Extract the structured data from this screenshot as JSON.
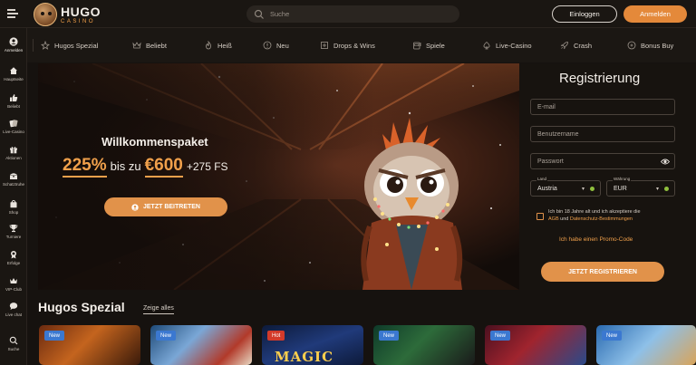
{
  "header": {
    "logo_line1": "HUGO",
    "logo_line2": "CASINO",
    "search_placeholder": "Suche",
    "login_label": "Einloggen",
    "register_label": "Anmelden",
    "accent_color": "#e4893a"
  },
  "sidebar": {
    "items": [
      {
        "label": "Anmelden",
        "icon": "user-icon"
      },
      {
        "label": "Hauptseite",
        "icon": "home-icon"
      },
      {
        "label": "Beliebt",
        "icon": "thumbs-up-icon"
      },
      {
        "label": "Live-Casino",
        "icon": "cards-icon"
      },
      {
        "label": "Aktionen",
        "icon": "gift-icon"
      },
      {
        "label": "Schatztruhe",
        "icon": "treasure-chest-icon"
      },
      {
        "label": "Shop",
        "icon": "shopping-bag-icon"
      },
      {
        "label": "Turniere",
        "icon": "trophy-icon"
      },
      {
        "label": "Erfolge",
        "icon": "achievement-icon"
      },
      {
        "label": "VIP-Club",
        "icon": "crown-icon"
      },
      {
        "label": "Live chat",
        "icon": "chat-icon"
      },
      {
        "label": "Suche",
        "icon": "search-icon"
      }
    ]
  },
  "categories": [
    {
      "label": "Hugos Spezial",
      "icon": "special-icon"
    },
    {
      "label": "Beliebt",
      "icon": "crown-icon"
    },
    {
      "label": "Heiß",
      "icon": "flame-icon"
    },
    {
      "label": "Neu",
      "icon": "new-icon"
    },
    {
      "label": "Drops & Wins",
      "icon": "drops-wins-icon"
    },
    {
      "label": "Spiele",
      "icon": "slot-machine-icon"
    },
    {
      "label": "Live-Casino",
      "icon": "live-casino-icon"
    },
    {
      "label": "Crash",
      "icon": "rocket-icon"
    },
    {
      "label": "Bonus Buy",
      "icon": "bonus-buy-icon"
    }
  ],
  "hero": {
    "title": "Willkommenspaket",
    "offer_percent": "225%",
    "offer_middle": "bis zu",
    "offer_amount": "€600",
    "offer_extra": "+275 FS",
    "join_button": "JETZT BEITRETEN"
  },
  "registration": {
    "title": "Registrierung",
    "email_placeholder": "E-mail",
    "username_placeholder": "Benutzername",
    "password_placeholder": "Passwort",
    "country_label": "Land",
    "country_value": "Austria",
    "currency_label": "Währung",
    "currency_value": "EUR",
    "consent_text": "Ich bin 18 Jahre alt und ich akzeptiere die",
    "consent_link1": "AGB",
    "consent_and": "und",
    "consent_link2": "Datenschutz-Bestimmungen",
    "promo_link": "Ich habe einen Promo-Code",
    "submit_button": "JETZT REGISTRIEREN"
  },
  "section": {
    "title": "Hugos Spezial",
    "show_all": "Zeige alles"
  },
  "tiles": [
    {
      "badge": "New",
      "badge_type": "new",
      "name": ""
    },
    {
      "badge": "New",
      "badge_type": "new",
      "name": ""
    },
    {
      "badge": "Hot",
      "badge_type": "hot",
      "name": "MAGIC"
    },
    {
      "badge": "New",
      "badge_type": "new",
      "name": ""
    },
    {
      "badge": "New",
      "badge_type": "new",
      "name": ""
    },
    {
      "badge": "New",
      "badge_type": "new",
      "name": ""
    }
  ]
}
